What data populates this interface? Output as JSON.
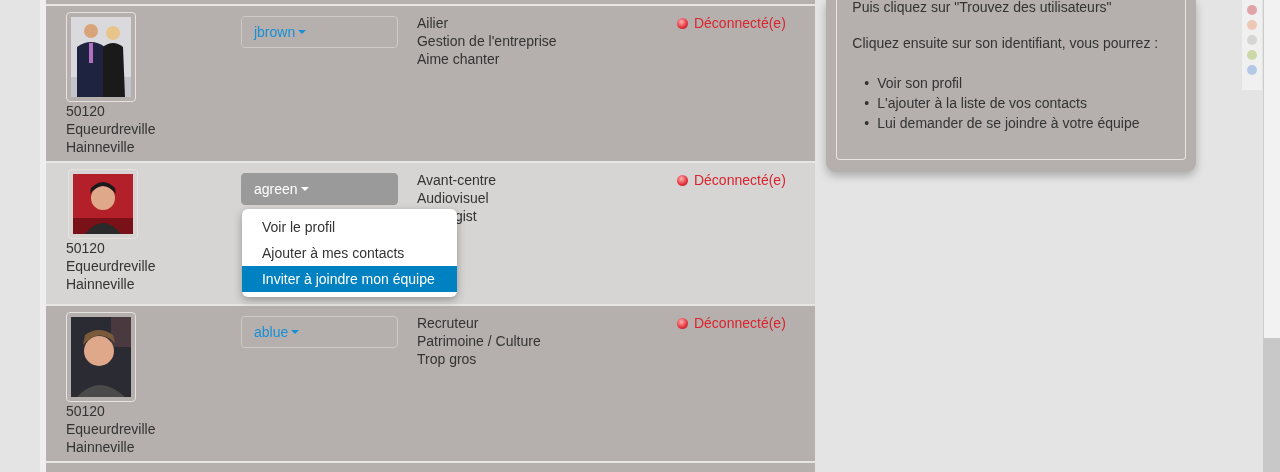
{
  "members": [
    {
      "photo": {
        "kind": "picture"
      },
      "postcode": "50120",
      "towns": [
        "Equeurdreville",
        "Hainneville"
      ],
      "username": "jbrown",
      "menu_open": false,
      "info": [
        {
          "text": "Ailier",
          "partial": false
        },
        {
          "text": "Gestion de l'entreprise",
          "partial": false
        },
        {
          "text": "Aime chanter",
          "partial": false
        }
      ],
      "status": "Déconnecté(e)",
      "selected": false
    },
    {
      "photo": {
        "kind": "picture"
      },
      "postcode": "50120",
      "towns": [
        "Equeurdreville",
        "Hainneville"
      ],
      "username": "agreen",
      "menu_open": true,
      "menu": [
        {
          "label": "Voir le profil",
          "selected": false
        },
        {
          "label": "Ajouter à mes contacts",
          "selected": false
        },
        {
          "label": "Inviter à joindre mon équipe",
          "selected": true
        }
      ],
      "info": [
        {
          "text": "Avant-centre",
          "partial": false
        },
        {
          "text": "Audiovisuel",
          "partial": false
        },
        {
          "text": "gist",
          "partial": true
        }
      ],
      "status": "Déconnecté(e)",
      "selected": true
    },
    {
      "photo": {
        "kind": "picture"
      },
      "postcode": "50120",
      "towns": [
        "Equeurdreville",
        "Hainneville"
      ],
      "username": "ablue",
      "menu_open": false,
      "info": [
        {
          "text": "Recruteur",
          "partial": false
        },
        {
          "text": "Patrimoine / Culture",
          "partial": false
        },
        {
          "text": "Trop gros",
          "partial": false
        }
      ],
      "status": "Déconnecté(e)",
      "selected": false
    }
  ],
  "help": {
    "lines": [
      "Puis cliquez sur \"Trouvez des utilisateurs\"",
      "Cliquez ensuite sur son identifiant, vous pourrez :"
    ],
    "marker": "•",
    "bullets": [
      "Voir son profil",
      "L'ajouter à la liste de vos contacts",
      "Lui demander de se joindre à votre équipe"
    ]
  },
  "color_dots": [
    {
      "color": "#e0a3a6"
    },
    {
      "color": "#edc8b4"
    },
    {
      "color": "#d8d6d4"
    },
    {
      "color": "#cdd8a8"
    },
    {
      "color": "#b3c9e6"
    }
  ]
}
